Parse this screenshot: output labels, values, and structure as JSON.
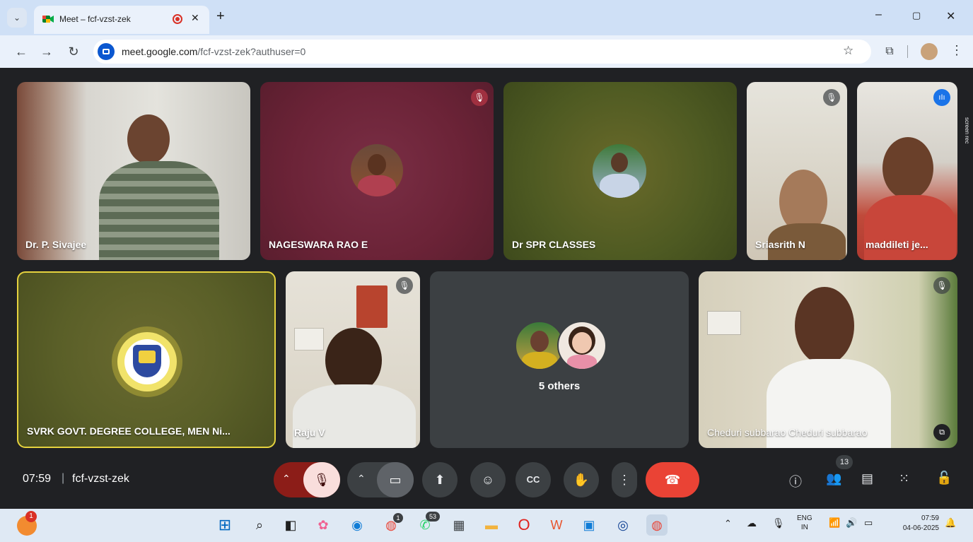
{
  "browser": {
    "tab_title": "Meet – fcf-vzst-zek",
    "url_host": "meet.google.com",
    "url_path": "/fcf-vzst-zek?authuser=0",
    "window_controls": [
      "–",
      "▢",
      "✕"
    ]
  },
  "tiles": [
    {
      "name": "Dr. P. Sivajee"
    },
    {
      "name": "NAGESWARA RAO E"
    },
    {
      "name": "Dr SPR CLASSES"
    },
    {
      "name": "Sriasrith N"
    },
    {
      "name": "maddileti je..."
    },
    {
      "name": "SVRK GOVT. DEGREE COLLEGE, MEN Ni..."
    },
    {
      "name": "Raju V"
    },
    {
      "others_label": "5 others"
    },
    {
      "name": "Cheduri subbarao Cheduri subbarao"
    }
  ],
  "side_label": "screen rec",
  "bottom_bar": {
    "time": "07:59",
    "separator": "|",
    "meeting_code": "fcf-vzst-zek",
    "people_count": "13"
  },
  "taskbar": {
    "notification_count": "1",
    "whatsapp_badge": "53",
    "chrome_badge": "1",
    "lang_line1": "ENG",
    "lang_line2": "IN",
    "time": "07:59",
    "date": "04-06-2025"
  },
  "colors": {
    "meet_bg": "#202124",
    "end_call": "#ea4335",
    "mic_off_bg": "#f9dedc",
    "active_speaker_border": "#e5d23e"
  }
}
